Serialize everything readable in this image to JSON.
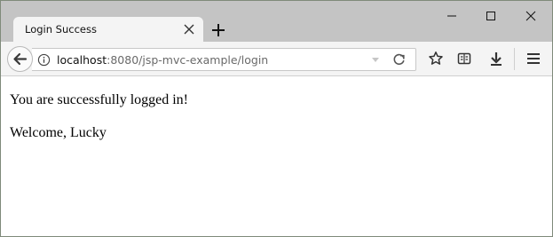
{
  "browser": {
    "tab": {
      "title": "Login Success"
    },
    "url": {
      "host": "localhost",
      "rest": ":8080/jsp-mvc-example/login"
    }
  },
  "page": {
    "message": "You are successfully logged in!",
    "welcome": "Welcome, Lucky"
  },
  "icons": {
    "back": "back-arrow-icon",
    "info": "info-icon",
    "reload": "reload-icon",
    "bookmark": "star-icon",
    "reader": "reader-view-icon",
    "download": "download-icon",
    "menu": "hamburger-menu-icon"
  },
  "colors": {
    "titlebar": "#c4c4c4",
    "toolbar": "#f4f4f4",
    "window_border": "#7f8a7a"
  }
}
